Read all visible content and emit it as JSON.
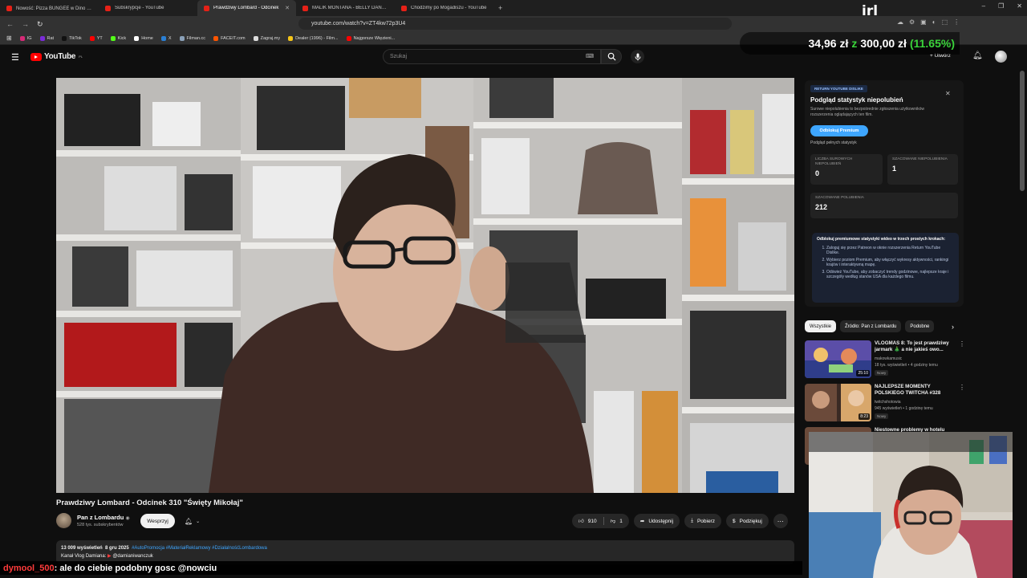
{
  "browser": {
    "tabs": [
      {
        "title": "Nowość: Pizza BUNGEE w Dino 🍕🤤",
        "active": false
      },
      {
        "title": "Subskrypcje - YouTube",
        "active": false
      },
      {
        "title": "Prawdziwy Lombard - Odcinek",
        "active": true
      },
      {
        "title": "MALIK MONTANA - BELLY DANCE X",
        "active": false
      },
      {
        "title": "Chodzimy po Mogadiszu - YouTube",
        "active": false
      }
    ],
    "new_tab": "+",
    "url": "youtube.com/watch?v=ZT4kw72p3U4",
    "bookmarks": [
      {
        "label": "IG",
        "color": "#d62976"
      },
      {
        "label": "Rat",
        "color": "#7a2bd8"
      },
      {
        "label": "TikTok",
        "color": "#111111"
      },
      {
        "label": "YT",
        "color": "#ff0000"
      },
      {
        "label": "Kick",
        "color": "#53fc18"
      },
      {
        "label": "Home",
        "color": "#ffffff"
      },
      {
        "label": "X",
        "color": "#2a7fd4"
      },
      {
        "label": "Filman.cc",
        "color": "#8aa0b8"
      },
      {
        "label": "FACEIT.com",
        "color": "#ff5500"
      },
      {
        "label": "Zagraj.my",
        "color": "#dddddd"
      },
      {
        "label": "Dealer (1996) - Film...",
        "color": "#f5c518"
      },
      {
        "label": "Najgorsze Więzieni...",
        "color": "#ff0000"
      }
    ]
  },
  "overlay": {
    "brand": "irl",
    "amount": "34,96 zł",
    "sep": "z",
    "goal": "300,00 zł",
    "percent": "(11.65%)"
  },
  "youtube": {
    "logo_text": "YouTube",
    "region": "PL",
    "search_placeholder": "Szukaj",
    "create_label": "+ Utwórz"
  },
  "video": {
    "title": "Prawdziwy Lombard - Odcinek 310 \"Święty Mikołaj\"",
    "channel": "Pan z Lombardu",
    "subscribers": "528 tys. subskrybentów",
    "support_label": "Wesprzyj",
    "likes": "910",
    "dislikes": "1",
    "share_label": "Udostępnij",
    "download_label": "Pobierz",
    "thanks_label": "Podziękuj",
    "views": "13 009 wyświetleń",
    "date": "8 gru 2025",
    "tags": "#AutoPromocja #MateriałReklamowy #DziałalnośćLombardowa",
    "desc_line2_prefix": "Kanał Vlog Damiana:",
    "desc_line2_handle": "@damianiwanczuk"
  },
  "chat": {
    "user": "dymool_500",
    "message": ": ale do ciebie podobny gosc @nowciu"
  },
  "dislike_panel": {
    "badge": "RETURN YOUTUBE DISLIKE",
    "title": "Podgląd statystyk niepolubień",
    "description": "Surowe niepolubienia to bezpośrednie zgłoszenia użytkowników rozszerzenia oglądających ten film.",
    "unlock_button": "Odblokuj Premium",
    "full_stats_link": "Podgląd pełnych statystyk",
    "stats": [
      {
        "label": "LICZBA SUROWYCH NIEPOLUBIEŃ",
        "value": "0"
      },
      {
        "label": "SZACOWANE NIEPOLUBIENIA",
        "value": "1"
      },
      {
        "label": "SZACOWANE POLUBIENIA",
        "value": "212"
      }
    ],
    "premium_heading": "Odblokuj premiumowe statystyki wideo w trzech prostych krokach:",
    "premium_steps": [
      "Zaloguj się przez Patreon w oknie rozszerzenia Return YouTube Dislike.",
      "Wybierz poziom Premium, aby włączyć wykresy aktywności, rankingi krajów i interaktywną mapę.",
      "Odśwież YouTube, aby zobaczyć trendy godzinowe, najlepsze kraje i szczegóły według stanów USA dla każdego filmu."
    ]
  },
  "chips": [
    "Wszystkie",
    "Źródło: Pan z Lombardu",
    "Podobne"
  ],
  "recommended": [
    {
      "title": "VLOGMAS 8: To jest prawdziwy jarmark 🎄 a nie jakieś owo...",
      "channel": "makowkamusic",
      "meta": "18 tys. wyświetleń • 4 godziny temu",
      "badge": "Nowy",
      "duration": "25:10"
    },
    {
      "title": "NAJLEPSZE MOMENTY POLSKIEGO TWITCHA #328",
      "channel": "twitchshotowia",
      "meta": "945 wyświetleń • 1 godzinę temu",
      "badge": "Nowy",
      "duration": "8:23"
    },
    {
      "title": "Niestowne problemy w hotelu",
      "channel": "",
      "meta": "",
      "badge": "",
      "duration": ""
    }
  ]
}
